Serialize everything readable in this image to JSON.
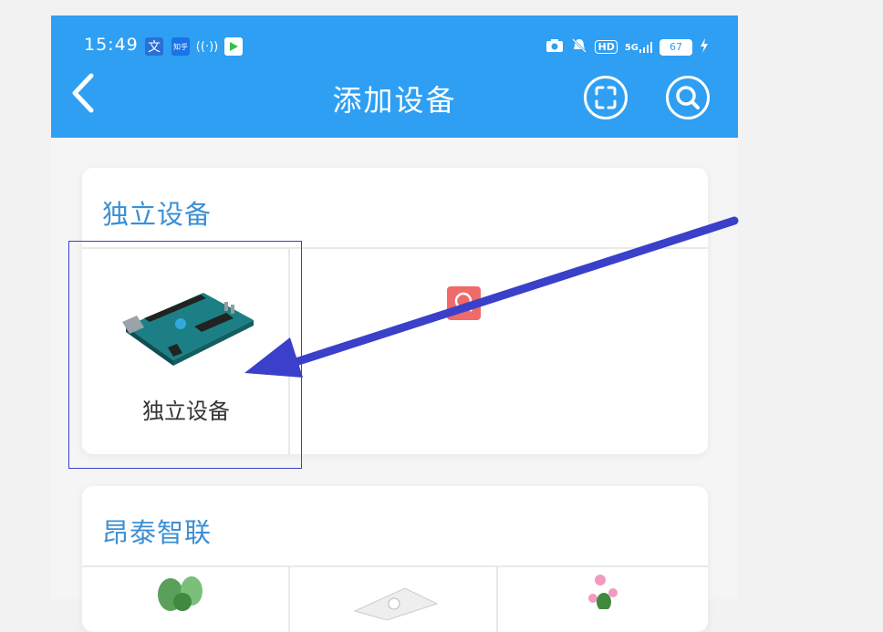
{
  "status_bar": {
    "time": "15:49",
    "network": "5G",
    "hd": "HD",
    "battery": "67",
    "left_icons": [
      "translate-icon",
      "zhihu-icon",
      "hotspot-icon",
      "video-app-icon"
    ]
  },
  "header": {
    "title": "添加设备",
    "back_icon": "chevron-left-icon",
    "scan_icon": "scan-icon",
    "search_icon": "search-icon"
  },
  "sections": [
    {
      "title": "独立设备",
      "devices": [
        {
          "label": "独立设备",
          "icon": "arduino-board-icon"
        }
      ]
    },
    {
      "title": "昂泰智联",
      "devices": [
        {
          "icon": "plant-icon"
        },
        {
          "icon": "device-box-icon"
        },
        {
          "icon": "flower-icon"
        }
      ]
    }
  ],
  "colors": {
    "header_bg": "#2e9ff3",
    "section_title": "#3c8fd4",
    "annotation": "#3a40c9",
    "badge": "#f06a6a"
  }
}
